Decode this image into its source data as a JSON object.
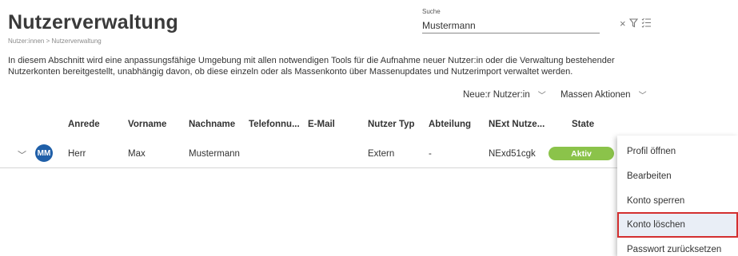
{
  "header": {
    "title": "Nutzerverwaltung",
    "breadcrumb": "Nutzer:innen > Nutzerverwaltung"
  },
  "search": {
    "label": "Suche",
    "value": "Mustermann",
    "icons": [
      "close-icon",
      "filter-icon",
      "filter-list-icon"
    ]
  },
  "description": "In diesem Abschnitt wird eine anpassungsfähige Umgebung mit allen notwendigen Tools für die Aufnahme neuer Nutzer:in oder die Verwaltung bestehender Nutzerkonten bereitgestellt, unabhängig davon, ob diese einzeln oder als Massenkonto über Massenupdates und Nutzerimport verwaltet werden.",
  "toolbar": {
    "new_user_label": "Neue:r Nutzer:in",
    "mass_actions_label": "Massen Aktionen"
  },
  "table": {
    "columns": [
      "Anrede",
      "Vorname",
      "Nachname",
      "Telefonnu...",
      "E-Mail",
      "Nutzer Typ",
      "Abteilung",
      "NExt Nutze...",
      "State"
    ],
    "rows": [
      {
        "avatar": "MM",
        "anrede": "Herr",
        "vorname": "Max",
        "nachname": "Mustermann",
        "telefon": "",
        "email": "",
        "nutzer_typ": "Extern",
        "abteilung": "-",
        "next_nutzer": "NExd51cgk",
        "state": "Aktiv"
      }
    ]
  },
  "context_menu": {
    "items": [
      "Profil öffnen",
      "Bearbeiten",
      "Konto sperren",
      "Konto löschen",
      "Passwort zurücksetzen"
    ],
    "highlighted_index": 3
  },
  "colors": {
    "avatar": "#1f5fa8",
    "status_active": "#8bc34a",
    "highlight_border": "#d32f2f"
  }
}
